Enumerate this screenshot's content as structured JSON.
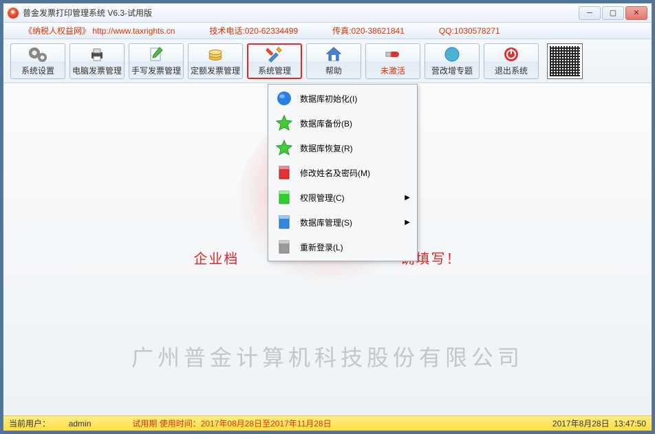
{
  "window": {
    "title": "普金发票打印管理系统 V6.3-试用版"
  },
  "info": {
    "site_label": "《纳税人权益网》 http://www.taxrights.cn",
    "tech_phone": "技术电话:020-62334499",
    "fax": "传真:020-38621841",
    "qq": "QQ:1030578271"
  },
  "toolbar": [
    {
      "label": "系统设置",
      "icon": "gears-icon"
    },
    {
      "label": "电脑发票管理",
      "icon": "printer-icon"
    },
    {
      "label": "手写发票管理",
      "icon": "pencil-note-icon"
    },
    {
      "label": "定额发票管理",
      "icon": "coins-icon"
    },
    {
      "label": "系统管理",
      "icon": "tools-icon",
      "highlighted": true
    },
    {
      "label": "帮助",
      "icon": "home-icon"
    },
    {
      "label": "未激活",
      "icon": "usb-icon",
      "red": true
    },
    {
      "label": "营改增专题",
      "icon": "globe-icon"
    },
    {
      "label": "退出系统",
      "icon": "power-icon"
    }
  ],
  "dropdown": [
    {
      "label": "数据库初始化(I)",
      "icon": "sphere-blue",
      "submenu": false
    },
    {
      "label": "数据库备份(B)",
      "icon": "star-green",
      "submenu": false
    },
    {
      "label": "数据库恢复(R)",
      "icon": "star-green",
      "submenu": false
    },
    {
      "label": "修改姓名及密码(M)",
      "icon": "book-red",
      "submenu": false
    },
    {
      "label": "权限管理(C)",
      "icon": "book-green",
      "submenu": true
    },
    {
      "label": "数据库管理(S)",
      "icon": "book-blue",
      "submenu": true
    },
    {
      "label": "重新登录(L)",
      "icon": "book-grey",
      "submenu": false
    }
  ],
  "banner_left": "企业档",
  "banner_right": "确填写！",
  "watermark_company": "广州普金计算机科技股份有限公司",
  "status": {
    "user_label": "当前用户：",
    "user": "admin",
    "trial": "试用期 使用时间：2017年08月28日至2017年11月28日",
    "date": "2017年8月28日",
    "time": "13:47:50"
  }
}
